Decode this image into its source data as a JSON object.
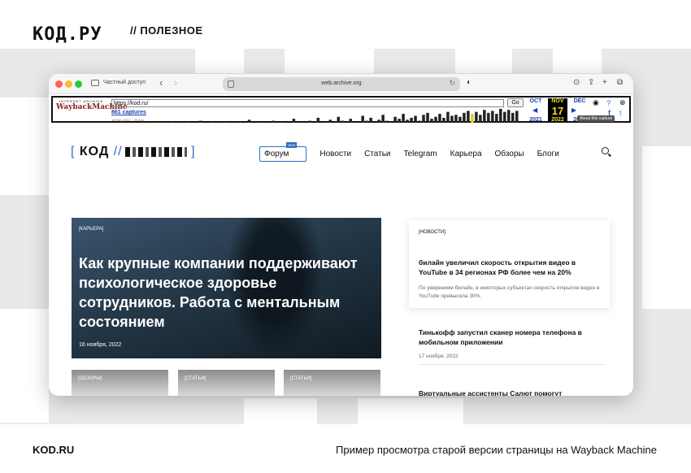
{
  "frame": {
    "brand": "КОД.РУ",
    "section": "// ПОЛЕЗНОЕ",
    "footer_left": "KOD.RU",
    "footer_right": "Пример просмотра старой версии страницы на Wayback Machine"
  },
  "browser": {
    "private_label": "Частный доступ",
    "address": "web.archive.org"
  },
  "wayback": {
    "logo_top": "INTERNET ARCHIVE",
    "logo_main": "WaybackMachine",
    "url_value": "https://kod.ru/",
    "go_label": "Go",
    "captures": "861 captures",
    "range": "18 May 2001 – 29 Aug",
    "months": [
      {
        "label": "OCT",
        "year": "2021"
      },
      {
        "label": "NOV",
        "day": "17",
        "year": "2022"
      },
      {
        "label": "DEC",
        "year": "2023"
      }
    ],
    "about": "About this capture",
    "spark": [
      1,
      0,
      0,
      1,
      0,
      0,
      0,
      1,
      0,
      0,
      2,
      0,
      0,
      1,
      0,
      0,
      1,
      0,
      0,
      0,
      1,
      0,
      3,
      0,
      0,
      1,
      0,
      0,
      2,
      0,
      1,
      0,
      0,
      4,
      0,
      1,
      0,
      2,
      0,
      5,
      0,
      1,
      3,
      0,
      6,
      2,
      0,
      4,
      1,
      0,
      7,
      2,
      5,
      0,
      3,
      8,
      2,
      1,
      6,
      4,
      9,
      3,
      5,
      7,
      2,
      8,
      10,
      4,
      6,
      9,
      5,
      11,
      7,
      8,
      6,
      10,
      12,
      9,
      11,
      8,
      13,
      10,
      12,
      9,
      14,
      11,
      13,
      10,
      12
    ]
  },
  "site": {
    "logo_text": "КОД",
    "nav": [
      "Форум",
      "Новости",
      "Статьи",
      "Telegram",
      "Карьера",
      "Обзоры",
      "Блоги"
    ],
    "new_badge": "NEW",
    "hero": {
      "tag": "[КАРЬЕРА]",
      "title": "Как крупные компании поддерживают психологическое здоровье сотрудников. Работа с ментальным состоянием",
      "date": "16 ноября, 2022"
    },
    "small_cards": [
      "[ОБЗОРЫ]",
      "[СТАТЬИ]",
      "[СТАТЬИ]"
    ],
    "feature": {
      "tag": "[НОВОСТИ]",
      "title": "билайн увеличил скорость открытия видео в YouTube в 34 регионах РФ более чем на 20%",
      "summary": "По уверениям билайн, в некоторых субъектах скорость открытия видео в YouTube превысила 30%."
    },
    "news": [
      {
        "title": "Тинькофф запустил сканер номера телефона в мобильном приложении",
        "date": "17 ноября, 2022"
      },
      {
        "title": "Виртуальные ассистенты Салют помогут",
        "date": ""
      }
    ]
  }
}
